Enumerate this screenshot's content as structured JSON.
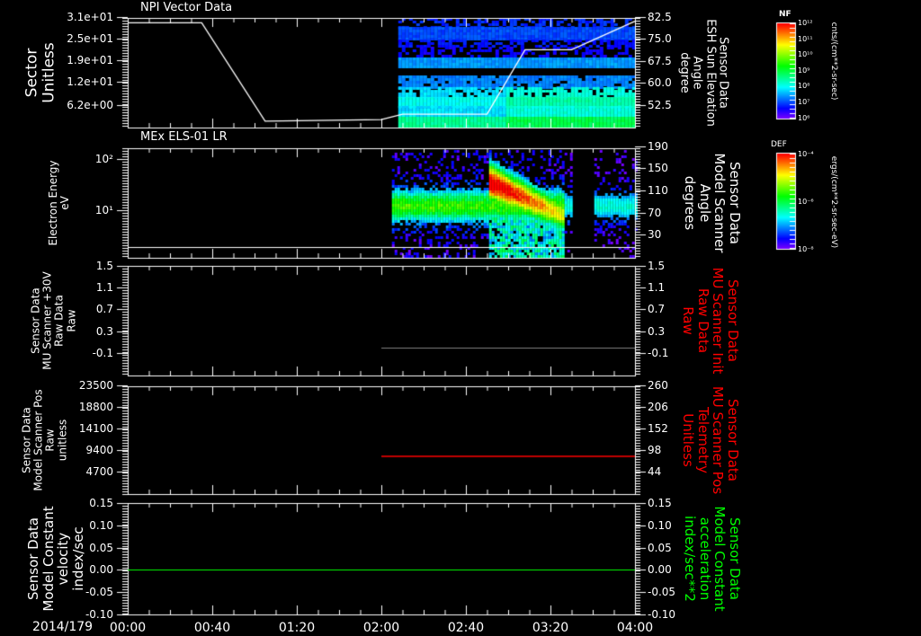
{
  "date_label": "2014/179",
  "colors": {
    "grey_line": "#808080",
    "red": "#ff0000",
    "green": "#00ff00",
    "white": "#ffffff"
  },
  "chart_data": [
    {
      "type": "heatmap",
      "title": "NPI Vector Data",
      "ylabel": [
        "Sector",
        "Unitless"
      ],
      "yticks": [
        "3.1e+01",
        "2.5e+01",
        "1.9e+01",
        "1.2e+01",
        "6.2e+00"
      ],
      "y2label": [
        "Sensor Data",
        "ESH Sun Elevation",
        "Angle",
        "degree"
      ],
      "y2ticks": [
        "82.5",
        "75.0",
        "67.5",
        "60.0",
        "52.5"
      ],
      "colorbar": {
        "title": "NF",
        "ticks": [
          "10¹²",
          "10¹¹",
          "10¹⁰",
          "10⁹",
          "10⁸",
          "10⁷",
          "10⁶"
        ],
        "units": "cnts/(cm**2-sr-sec)"
      },
      "overlay_line": {
        "y2_units": "degree",
        "points": [
          [
            "00:00",
            81
          ],
          [
            "00:35",
            81
          ],
          [
            "01:05",
            50
          ],
          [
            "02:00",
            50.5
          ],
          [
            "02:10",
            52.2
          ],
          [
            "02:50",
            52.2
          ],
          [
            "03:08",
            72.5
          ],
          [
            "03:30",
            72.5
          ],
          [
            "04:00",
            81.5
          ]
        ]
      },
      "data_start": "02:08"
    },
    {
      "type": "heatmap",
      "title": "MEx ELS-01 LR",
      "ylabel": [
        "Electron Energy",
        "eV"
      ],
      "yticks": [
        "10²",
        "10¹"
      ],
      "yscale": "log",
      "y2label": [
        "Sensor Data",
        "Model Scanner",
        "Angle",
        "degrees"
      ],
      "y2ticks": [
        "190",
        "150",
        "110",
        "70",
        "30"
      ],
      "colorbar": {
        "title": "DEF",
        "ticks": [
          "10⁻⁴",
          "10⁻⁶",
          "10⁻⁸"
        ],
        "units": "ergs/(cm**2-sr-sec-eV)"
      },
      "data_start": "02:05",
      "intense_event": [
        "02:50",
        "03:10"
      ]
    },
    {
      "type": "line",
      "ylabel": [
        "Sensor Data",
        "MU Scanner +30V",
        "Raw Data",
        "Raw"
      ],
      "yticks": [
        "1.5",
        "1.1",
        "0.7",
        "0.3",
        "-0.1"
      ],
      "ylim": [
        -0.3,
        1.5
      ],
      "y2label": [
        "Sensor Data",
        "MU Scanner Init",
        "Raw Data",
        "Raw"
      ],
      "y2ticks": [
        "1.5",
        "1.1",
        "0.7",
        "0.3",
        "-0.1"
      ],
      "series": [
        {
          "x": [
            "02:00",
            "04:00"
          ],
          "y": [
            -0.04,
            -0.04
          ],
          "color": "#808080"
        }
      ]
    },
    {
      "type": "line",
      "ylabel": [
        "Sensor Data",
        "Model Scanner Pos",
        "Raw",
        "unitless"
      ],
      "yticks": [
        "23500",
        "18800",
        "14100",
        "9400",
        "4700"
      ],
      "y2label": [
        "Sensor Data",
        "MU Scanner Pos",
        "Telemetry",
        "Unitless"
      ],
      "y2ticks": [
        "260",
        "206",
        "152",
        "98",
        "44"
      ],
      "series": [
        {
          "x": [
            "02:00",
            "04:00"
          ],
          "y2": [
            91,
            91
          ],
          "color": "#ff0000"
        }
      ]
    },
    {
      "type": "line",
      "ylabel": [
        "Sensor Data",
        "Model Constant",
        "velocity",
        "index/sec"
      ],
      "yticks": [
        "0.15",
        "0.10",
        "0.05",
        "0.00",
        "-0.05",
        "-0.10"
      ],
      "ylim": [
        -0.1,
        0.15
      ],
      "y2label": [
        "Sensor Data",
        "Model Constant",
        "acceleration",
        "index/sec**2"
      ],
      "y2ticks": [
        "0.15",
        "0.10",
        "0.05",
        "0.00",
        "-0.05",
        "-0.10"
      ],
      "series": [
        {
          "x": [
            "00:00",
            "04:00"
          ],
          "y": [
            0,
            0
          ],
          "color": "#00ff00"
        }
      ]
    }
  ],
  "xticks": [
    "00:00",
    "00:40",
    "01:20",
    "02:00",
    "02:40",
    "03:20",
    "04:00"
  ]
}
